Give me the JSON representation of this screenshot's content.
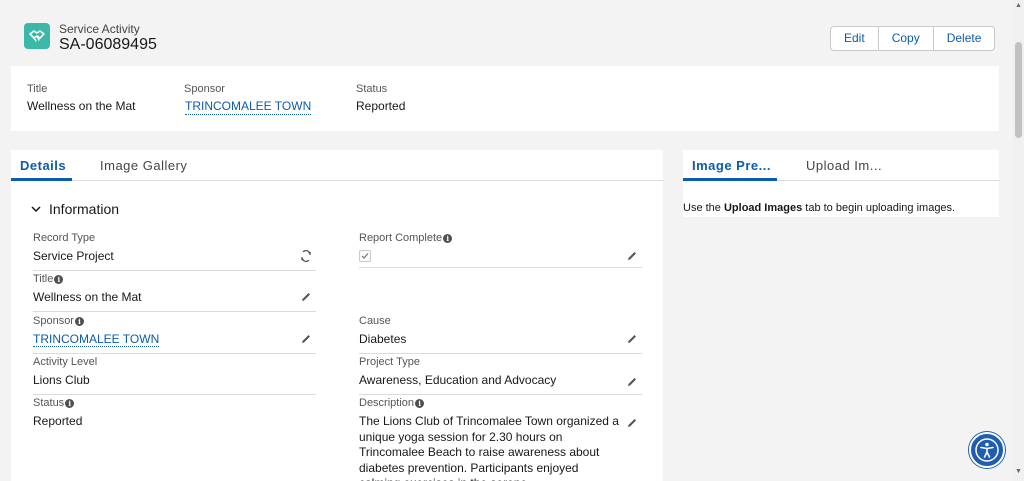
{
  "header": {
    "object_type": "Service Activity",
    "record_name": "SA-06089495",
    "icon": "handshake-icon",
    "actions": [
      "Edit",
      "Copy",
      "Delete"
    ]
  },
  "highlights": {
    "fields": [
      {
        "label": "Title",
        "value": "Wellness on the Mat"
      },
      {
        "label": "Sponsor",
        "value": "TRINCOMALEE TOWN"
      },
      {
        "label": "Status",
        "value": "Reported"
      }
    ]
  },
  "main": {
    "tabs": [
      "Details",
      "Image Gallery"
    ],
    "section_title": "Information",
    "left_fields": [
      {
        "label": "Record Type",
        "value": "Service Project"
      },
      {
        "label": "Title",
        "value": "Wellness on the Mat"
      },
      {
        "label": "Sponsor",
        "value": "TRINCOMALEE TOWN"
      },
      {
        "label": "Activity Level",
        "value": "Lions Club"
      },
      {
        "label": "Status",
        "value": "Reported"
      }
    ],
    "right_fields": [
      {
        "label": "Report Complete",
        "checked": true
      },
      {
        "label": "Cause",
        "value": "Diabetes"
      },
      {
        "label": "Project Type",
        "value": "Awareness, Education and Advocacy"
      },
      {
        "label": "Description",
        "value": "The Lions Club of Trincomalee Town organized a unique yoga session for 2.30 hours on Trincomalee Beach to raise awareness about diabetes prevention. Participants enjoyed calming exercises in the serene"
      }
    ]
  },
  "side": {
    "tabs": [
      "Image Pre...",
      "Upload Im..."
    ],
    "message_prefix": "Use the ",
    "message_bold": "Upload Images",
    "message_suffix": " tab to begin uploading images."
  },
  "colors": {
    "accent": "#0b5cab",
    "icon_bg": "#3bb8a6",
    "a11y_button": "#1e5db0"
  }
}
